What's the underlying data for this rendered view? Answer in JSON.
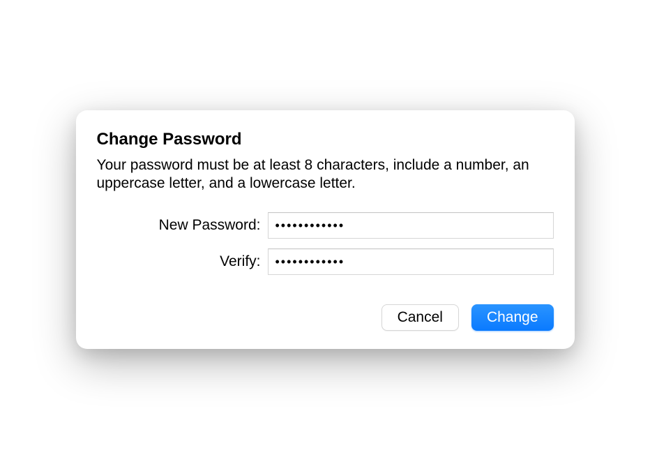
{
  "dialog": {
    "title": "Change Password",
    "description": "Your password must be at least 8 characters, include a number, an uppercase letter, and a lowercase letter.",
    "fields": {
      "new_password": {
        "label": "New Password:",
        "value": "●●●●●●●●●●●●"
      },
      "verify": {
        "label": "Verify:",
        "value": "●●●●●●●●●●●●"
      }
    },
    "buttons": {
      "cancel": "Cancel",
      "change": "Change"
    }
  }
}
